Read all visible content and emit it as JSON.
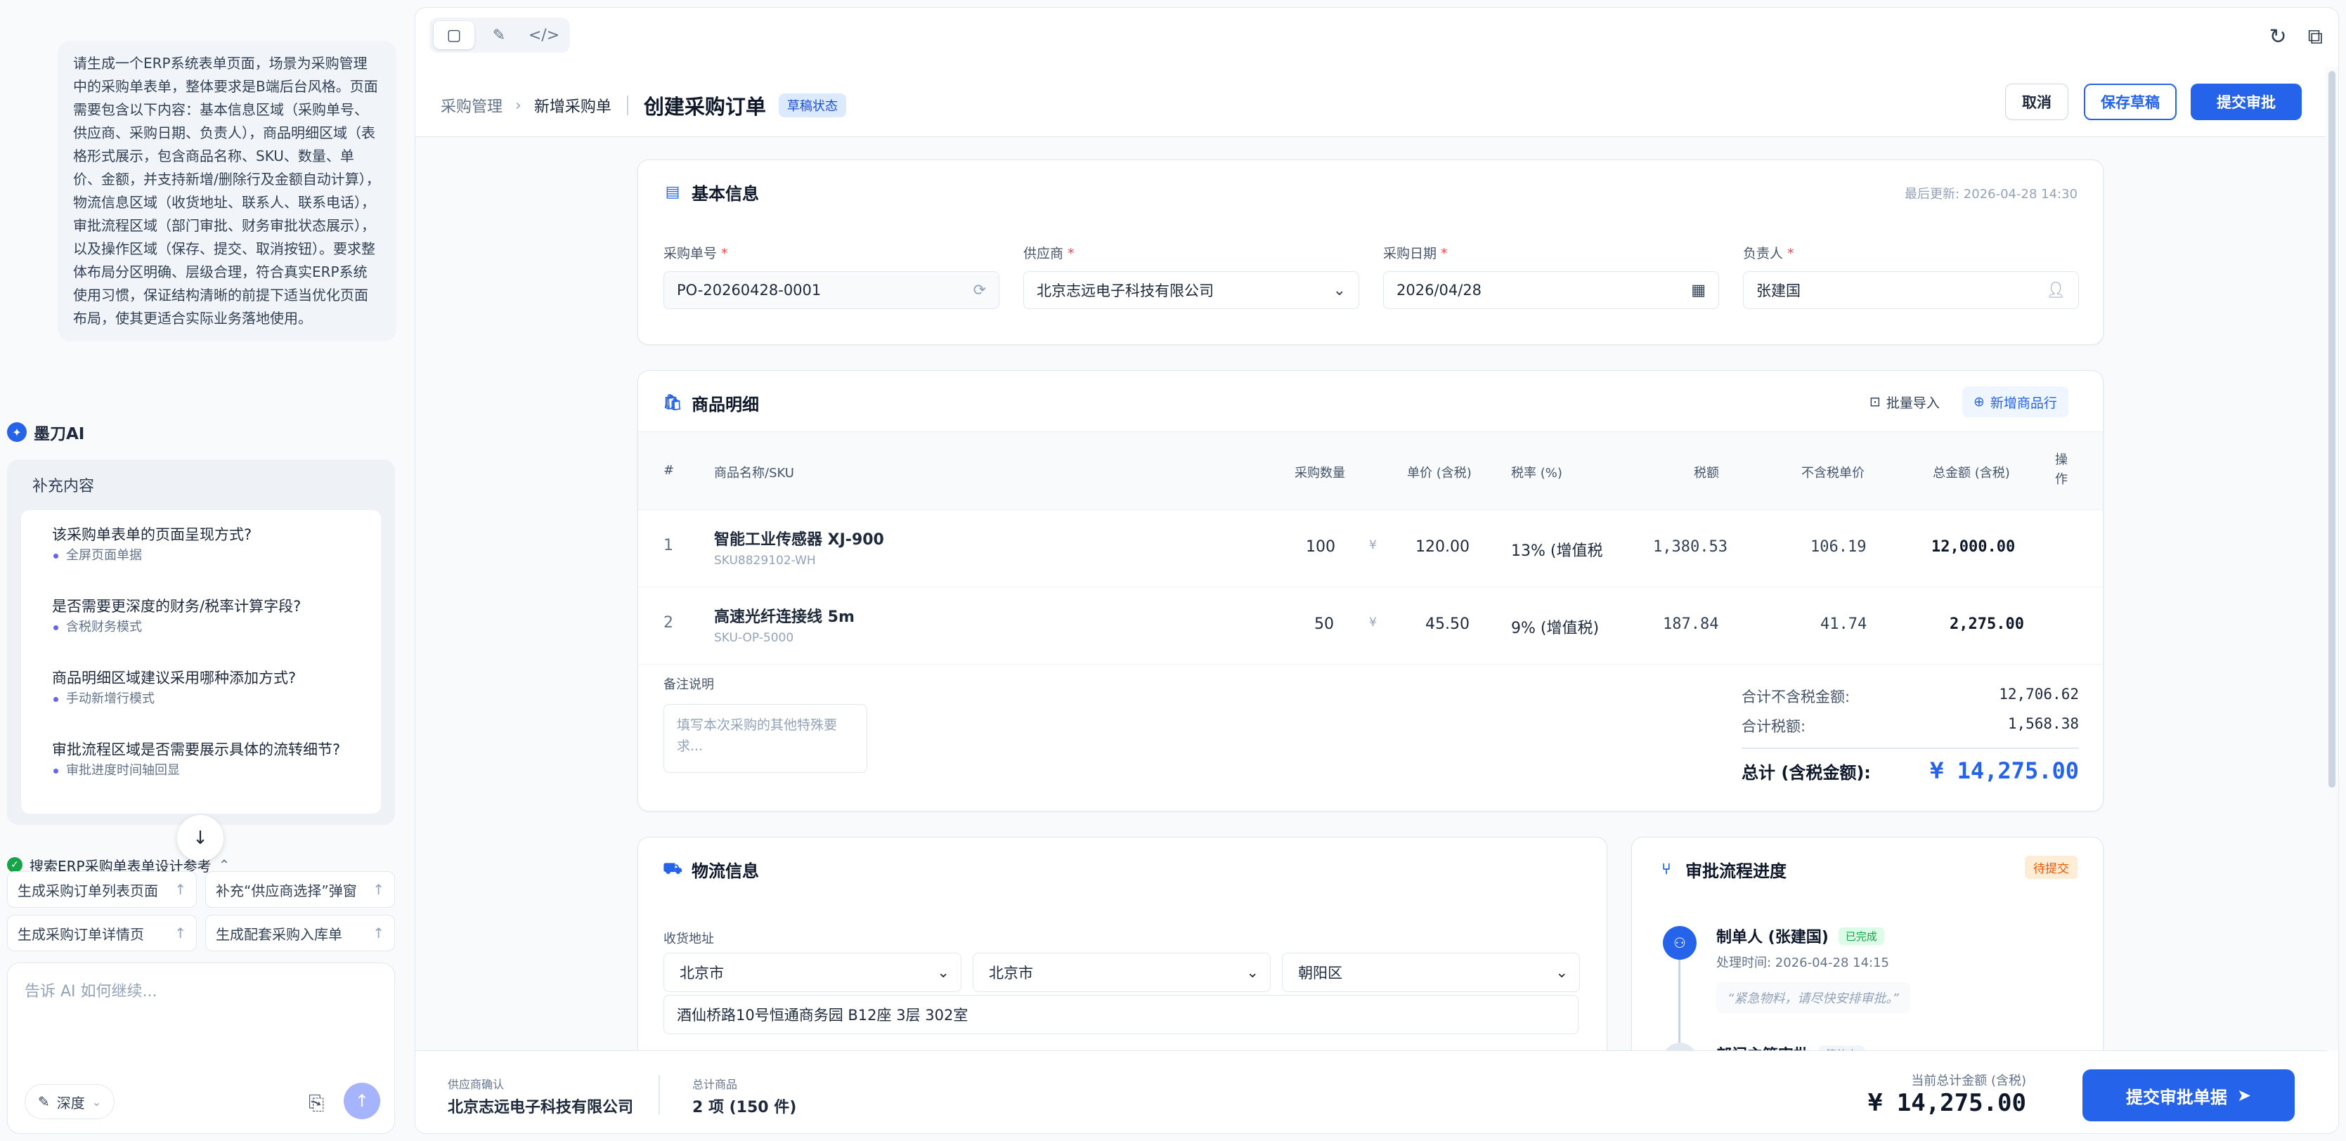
{
  "chat": {
    "user_message": "请生成一个ERP系统表单页面，场景为采购管理中的采购单表单，整体要求是B端后台风格。页面需要包含以下内容：基本信息区域（采购单号、供应商、采购日期、负责人），商品明细区域（表格形式展示，包含商品名称、SKU、数量、单价、金额，并支持新增/删除行及金额自动计算），物流信息区域（收货地址、联系人、联系电话），审批流程区域（部门审批、财务审批状态展示），以及操作区域（保存、提交、取消按钮）。要求整体布局分区明确、层级合理，符合真实ERP系统使用习惯，保证结构清晰的前提下适当优化页面布局，使其更适合实际业务落地使用。",
    "brand": "墨刀AI",
    "supp_title": "补充内容",
    "questions": [
      {
        "q": "该采购单表单的页面呈现方式?",
        "a": "全屏页面单据"
      },
      {
        "q": "是否需要更深度的财务/税率计算字段?",
        "a": "含税财务模式"
      },
      {
        "q": "商品明细区域建议采用哪种添加方式?",
        "a": "手动新增行模式"
      },
      {
        "q": "审批流程区域是否需要展示具体的流转细节?",
        "a": "审批进度时间轴回显"
      }
    ],
    "search_ref": "搜索ERP采购单表单设计参考",
    "suggestions": [
      "生成采购订单列表页面",
      "补充“供应商选择”弹窗",
      "生成采购订单详情页",
      "生成配套采购入库单"
    ],
    "composer_placeholder": "告诉 AI 如何继续...",
    "depth_label": "深度"
  },
  "page": {
    "crumb_root": "采购管理",
    "crumb_current": "新增采购单",
    "title": "创建采购订单",
    "status_badge": "草稿状态",
    "btn_cancel": "取消",
    "btn_draft": "保存草稿",
    "btn_submit": "提交审批"
  },
  "basic": {
    "title": "基本信息",
    "updated": "最后更新: 2026-04-28 14:30",
    "fields": [
      {
        "label": "采购单号",
        "value": "PO-20260428-0001"
      },
      {
        "label": "供应商",
        "value": "北京志远电子科技有限公司"
      },
      {
        "label": "采购日期",
        "value": "2026/04/28"
      },
      {
        "label": "负责人",
        "value": "张建国"
      }
    ]
  },
  "items": {
    "title": "商品明细",
    "btn_import": "批量导入",
    "btn_add": "新增商品行",
    "headers": [
      "#",
      "商品名称/SKU",
      "采购数量",
      "单价 (含税)",
      "税率 (%)",
      "税额",
      "不含税单价",
      "总金额 (含税)",
      "操作"
    ],
    "rows": [
      {
        "idx": "1",
        "name": "智能工业传感器 XJ-900",
        "sku": "SKU8829102-WH",
        "qty": "100",
        "currency": "¥",
        "price": "120.00",
        "tax_rate": "13% (增值税",
        "tax": "1,380.53",
        "net_price": "106.19",
        "total": "12,000.00"
      },
      {
        "idx": "2",
        "name": "高速光纤连接线 5m",
        "sku": "SKU-OP-5000",
        "qty": "50",
        "currency": "¥",
        "price": "45.50",
        "tax_rate": "9% (增值税)",
        "tax": "187.84",
        "net_price": "41.74",
        "total": "2,275.00"
      }
    ],
    "remark_label": "备注说明",
    "remark_placeholder": "填写本次采购的其他特殊要求...",
    "sum_net_label": "合计不含税金额:",
    "sum_net": "12,706.62",
    "sum_tax_label": "合计税额:",
    "sum_tax": "1,568.38",
    "total_label": "总计 (含税金额):",
    "total": "¥ 14,275.00"
  },
  "logistics": {
    "title": "物流信息",
    "addr_label": "收货地址",
    "province": "北京市",
    "city": "北京市",
    "district": "朝阳区",
    "address": "酒仙桥路10号恒通商务园 B12座 3层 302室"
  },
  "approval": {
    "title": "审批流程进度",
    "status": "待提交",
    "step1_name": "制单人 (张建国)",
    "step1_tag": "已完成",
    "step1_time": "处理时间: 2026-04-28 14:15",
    "step1_note": "“紧急物料，请尽快安排审批。”",
    "step2_name": "部门主管审批",
    "step2_tag": "等待中"
  },
  "footer": {
    "supplier_label": "供应商确认",
    "supplier": "北京志远电子科技有限公司",
    "count_label": "总计商品",
    "count": "2 项 (150 件)",
    "grand_label": "当前总计金额 (含税)",
    "grand": "¥ 14,275.00",
    "submit": "提交审批单据"
  },
  "colors": {
    "primary": "#2563eb",
    "success": "#16a34a",
    "warning": "#ea580c"
  }
}
